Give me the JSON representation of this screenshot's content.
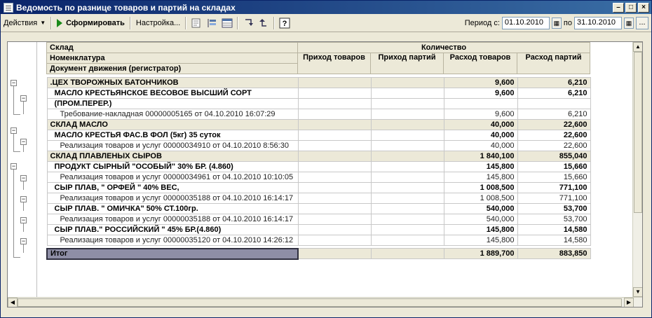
{
  "window": {
    "title": "Ведомость по разнице товаров и партий на складах"
  },
  "toolbar": {
    "actions_label": "Действия",
    "generate_label": "Сформировать",
    "settings_label": "Настройка...",
    "period_from_label": "Период с:",
    "period_from_value": "01.10.2010",
    "period_to_label": "по",
    "period_to_value": "31.10.2010",
    "more_label": "..."
  },
  "headers": {
    "row1_col1": "Склад",
    "row1_qty": "Количество",
    "row2_col1": "Номенклатура",
    "row3_col1": "Документ движения (регистратор)",
    "col_in_goods": "Приход товаров",
    "col_in_batches": "Приход партий",
    "col_out_goods": "Расход товаров",
    "col_out_batches": "Расход партий"
  },
  "rows": [
    {
      "kind": "grp",
      "name": ".ЦЕХ ТВОРОЖНЫХ БАТОНЧИКОВ",
      "c1": "",
      "c2": "",
      "c3": "9,600",
      "c4": "6,210"
    },
    {
      "kind": "item",
      "name": "МАСЛО КРЕСТЬЯНСКОЕ ВЕСОВОЕ ВЫСШИЙ СОРТ",
      "c1": "",
      "c2": "",
      "c3": "9,600",
      "c4": "6,210"
    },
    {
      "kind": "item2",
      "name": "(ПРОМ.ПЕРЕР.)",
      "c1": "",
      "c2": "",
      "c3": "",
      "c4": ""
    },
    {
      "kind": "doc",
      "name": "Требование-накладная 00000005165 от 04.10.2010 16:07:29",
      "c1": "",
      "c2": "",
      "c3": "9,600",
      "c4": "6,210"
    },
    {
      "kind": "grp",
      "name": "СКЛАД МАСЛО",
      "c1": "",
      "c2": "",
      "c3": "40,000",
      "c4": "22,600"
    },
    {
      "kind": "item",
      "name": "МАСЛО КРЕСТЬЯ ФАС.В ФОЛ (5кг) 35 суток",
      "c1": "",
      "c2": "",
      "c3": "40,000",
      "c4": "22,600"
    },
    {
      "kind": "doc",
      "name": "Реализация товаров и услуг 00000034910 от 04.10.2010 8:56:30",
      "c1": "",
      "c2": "",
      "c3": "40,000",
      "c4": "22,600"
    },
    {
      "kind": "grp",
      "name": "СКЛАД ПЛАВЛЕНЫХ СЫРОВ",
      "c1": "",
      "c2": "",
      "c3": "1 840,100",
      "c4": "855,040"
    },
    {
      "kind": "item",
      "name": "ПРОДУКТ СЫРНЫЙ \"ОСОБЫЙ\" 30% БР. (4.860)",
      "c1": "",
      "c2": "",
      "c3": "145,800",
      "c4": "15,660"
    },
    {
      "kind": "doc",
      "name": "Реализация товаров и услуг 00000034961 от 04.10.2010 10:10:05",
      "c1": "",
      "c2": "",
      "c3": "145,800",
      "c4": "15,660"
    },
    {
      "kind": "item",
      "name": "СЫР ПЛАВ, \" ОРФЕЙ \" 40% ВЕС,",
      "c1": "",
      "c2": "",
      "c3": "1 008,500",
      "c4": "771,100"
    },
    {
      "kind": "doc",
      "name": "Реализация товаров и услуг 00000035188 от 04.10.2010 16:14:17",
      "c1": "",
      "c2": "",
      "c3": "1 008,500",
      "c4": "771,100"
    },
    {
      "kind": "item",
      "name": "СЫР ПЛАВ. \" ОМИЧКА\"          50%   СТ.100гр.",
      "c1": "",
      "c2": "",
      "c3": "540,000",
      "c4": "53,700"
    },
    {
      "kind": "doc",
      "name": "Реализация товаров и услуг 00000035188 от 04.10.2010 16:14:17",
      "c1": "",
      "c2": "",
      "c3": "540,000",
      "c4": "53,700"
    },
    {
      "kind": "item",
      "name": "СЫР ПЛАВ.\" РОССИЙСКИЙ \"  45%  БР.(4.860)",
      "c1": "",
      "c2": "",
      "c3": "145,800",
      "c4": "14,580"
    },
    {
      "kind": "doc",
      "name": "Реализация товаров и услуг 00000035120 от 04.10.2010 14:26:12",
      "c1": "",
      "c2": "",
      "c3": "145,800",
      "c4": "14,580"
    }
  ],
  "total": {
    "label": "Итог",
    "c1": "",
    "c2": "",
    "c3": "1 889,700",
    "c4": "883,850"
  }
}
